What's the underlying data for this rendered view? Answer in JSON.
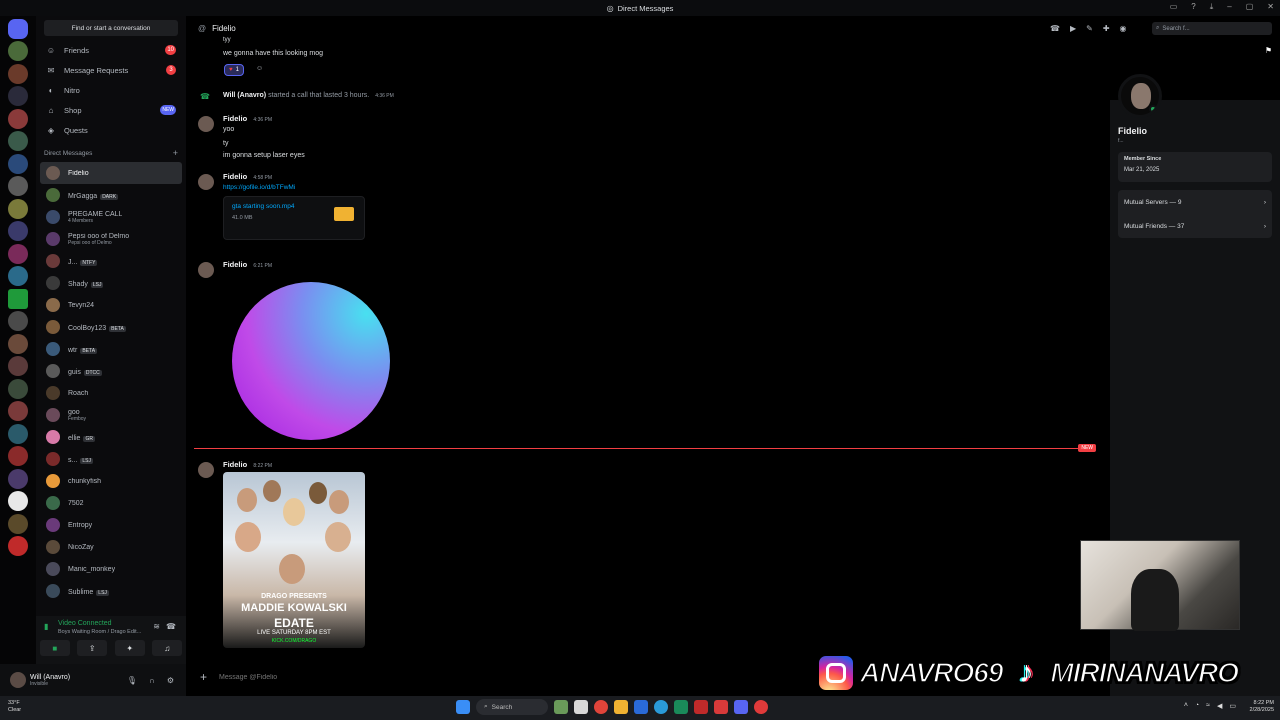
{
  "window": {
    "title": "Direct Messages",
    "search_placeholder": "Search f..."
  },
  "sidebar": {
    "find_label": "Find or start a conversation",
    "nav": [
      {
        "label": "Friends",
        "badge": "10"
      },
      {
        "label": "Message Requests",
        "badge": "3"
      },
      {
        "label": "Nitro",
        "badge": ""
      },
      {
        "label": "Shop",
        "badge": "NEW"
      },
      {
        "label": "Quests",
        "badge": ""
      }
    ],
    "dm_header": "Direct Messages",
    "dms": [
      {
        "name": "Fidelio",
        "sub": "",
        "tag": "",
        "color": "#6b5a52"
      },
      {
        "name": "MrGagga",
        "sub": "",
        "tag": "DARK",
        "color": "#4a6a3a"
      },
      {
        "name": "PREGAME CALL",
        "sub": "4 Members",
        "tag": "",
        "color": "#3a4a6a"
      },
      {
        "name": "Pepsi ooo of Delmo",
        "sub": "Pepsi ooo of Delmo",
        "tag": "",
        "color": "#5a3a6a"
      },
      {
        "name": "J...",
        "sub": "",
        "tag": "NTFY",
        "color": "#6a3a3a"
      },
      {
        "name": "Shady",
        "sub": "",
        "tag": "LSJ",
        "color": "#3a3a3a"
      },
      {
        "name": "Tevyn24",
        "sub": "",
        "tag": "",
        "color": "#8a6a4a"
      },
      {
        "name": "CoolBoy123",
        "sub": "",
        "tag": "BETA",
        "color": "#7a5a3a"
      },
      {
        "name": "wtr",
        "sub": "",
        "tag": "BETA",
        "color": "#3a5a7a"
      },
      {
        "name": "guis",
        "sub": "",
        "tag": "DTCC",
        "color": "#5a5a5a"
      },
      {
        "name": "Roach",
        "sub": "",
        "tag": "",
        "color": "#4a3a2a"
      },
      {
        "name": "goo",
        "sub": "Femboy",
        "tag": "",
        "color": "#6a4a5a"
      },
      {
        "name": "ellie",
        "sub": "",
        "tag": "GR",
        "color": "#d87aa8"
      },
      {
        "name": "s...",
        "sub": "",
        "tag": "LSJ",
        "color": "#7a2a2a"
      },
      {
        "name": "chunkyfish",
        "sub": "",
        "tag": "",
        "color": "#e89a3a"
      },
      {
        "name": "7502",
        "sub": "",
        "tag": "",
        "color": "#3a6a4a"
      },
      {
        "name": "Entropy",
        "sub": "",
        "tag": "",
        "color": "#6a3a7a"
      },
      {
        "name": "NicoZay",
        "sub": "",
        "tag": "",
        "color": "#5a4a3a"
      },
      {
        "name": "Manic_monkey",
        "sub": "",
        "tag": "",
        "color": "#4a4a5a"
      },
      {
        "name": "Sublime",
        "sub": "",
        "tag": "LSJ",
        "color": "#3a4a5a"
      }
    ]
  },
  "voice": {
    "status": "Video Connected",
    "channel": "Boys Waiting Room / Drago Edit..."
  },
  "user": {
    "name": "Will (Anavro)",
    "status": "Invisible"
  },
  "chat": {
    "header_name": "Fidelio",
    "top_lines": [
      "tyy",
      "we gonna have this looking mog"
    ],
    "reaction_count": "1",
    "call_actor": "Will (Anavro)",
    "call_text": "started a call that lasted 3 hours.",
    "call_time": "4:36 PM",
    "messages": [
      {
        "author": "Fidelio",
        "time": "4:36 PM",
        "lines": [
          "yoo",
          "ty",
          "im gonna setup laser eyes"
        ]
      },
      {
        "author": "Fidelio",
        "time": "4:58 PM",
        "link": "https://gofile.io/d/bTFwMi",
        "file_name": "gta starting soon.mp4",
        "file_size": "41.0 MB"
      },
      {
        "author": "Fidelio",
        "time": "6:21 PM"
      },
      {
        "author": "Fidelio",
        "time": "8:22 PM"
      }
    ],
    "new_label": "NEW",
    "poster": {
      "line1": "DRAGO PRESENTS",
      "line2": "MADDIE KOWALSKI",
      "line3": "EDATE",
      "line4": "LIVE SATURDAY 8PM EST",
      "line5": "KICK.COM/DRAGO"
    },
    "composer_placeholder": "Message @Fidelio"
  },
  "profile": {
    "name": "Fidelio",
    "mini": "f...",
    "member_since_label": "Member Since",
    "member_since": "Mar 21, 2025",
    "mutual_servers": "Mutual Servers — 9",
    "mutual_friends": "Mutual Friends — 37"
  },
  "social": {
    "ig_handle": "ANAVRO69",
    "tt_handle": "MIRINANAVRO"
  },
  "taskbar": {
    "temp": "33°F",
    "weather": "Clear",
    "search": "Search",
    "time": "8:22 PM",
    "date": "2/28/2025"
  }
}
